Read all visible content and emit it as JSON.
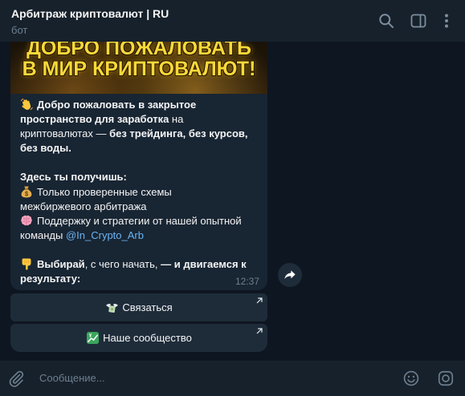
{
  "chat": {
    "title": "Арбитраж криптовалют | RU",
    "subtitle": "бот"
  },
  "header": {
    "icons": [
      "search-icon",
      "sidebar-toggle-icon",
      "more-vertical-icon"
    ]
  },
  "message": {
    "banner": {
      "line1": "ДОБРО ПОЖАЛОВАТЬ",
      "line2": "В МИР КРИПТОВАЛЮТ!"
    },
    "emoji": {
      "greeting": "waving-hand-icon",
      "money": "money-bag-icon",
      "brain": "brain-icon",
      "point": "pointing-down-icon"
    },
    "text": [
      [
        "Добро пожаловать в закрытое"
      ],
      [
        "пространство для заработка",
        " на"
      ],
      [
        "криптовалютах — ",
        "без трейдинга, без курсов,"
      ],
      [
        "без воды."
      ],
      [],
      [
        "Здесь ты получишь:"
      ],
      [
        "Только проверенные схемы"
      ],
      [
        "межбиржевого арбитража"
      ],
      [
        "Поддержку и стратегии от нашей опытной"
      ],
      [
        "команды ",
        "@In_Crypto_Arb"
      ],
      [],
      [
        "Выбирай",
        ", с чего начать, ",
        "— и двигаемся к"
      ],
      [
        "результату:"
      ]
    ],
    "time": "12:37",
    "forward_icon": "forward-icon"
  },
  "buttons": [
    {
      "icon": "money-with-wings-icon",
      "label": "Связаться",
      "indicator_icon": "link-arrow-icon"
    },
    {
      "icon": "chart-increasing-icon",
      "label": "Наше сообщество",
      "indicator_icon": "link-arrow-icon"
    }
  ],
  "composer": {
    "placeholder": "Сообщение...",
    "icons": [
      "attach-icon",
      "emoji-icon",
      "video-message-icon"
    ]
  },
  "colors": {
    "header_bg": "#17212b",
    "chat_bg": "#0e1621",
    "bubble_bg": "#182533",
    "button_bg": "#1e2c3a",
    "link": "#6ab3f3",
    "muted": "#6d7f8f",
    "text": "#f5f5f5",
    "banner_text": "#f8d93a"
  }
}
